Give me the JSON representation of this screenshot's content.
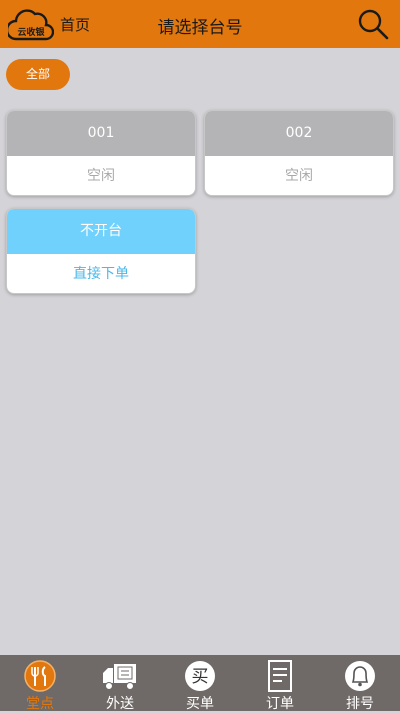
{
  "header": {
    "logo_text": "云收银",
    "home_label": "首页",
    "title": "请选择台号"
  },
  "filter": {
    "label": "全部"
  },
  "tables": [
    {
      "number": "001",
      "status": "空闲"
    },
    {
      "number": "002",
      "status": "空闲"
    },
    {
      "number": "不开台",
      "status": "直接下单"
    }
  ],
  "tabbar": {
    "items": [
      {
        "label": "堂点",
        "icon": "dine-in-icon"
      },
      {
        "label": "外送",
        "icon": "delivery-truck-icon"
      },
      {
        "label": "买单",
        "icon": "checkout-icon",
        "glyph": "买"
      },
      {
        "label": "订单",
        "icon": "order-list-icon"
      },
      {
        "label": "排号",
        "icon": "bell-icon"
      }
    ]
  },
  "colors": {
    "accent": "#e2770e",
    "idle_header": "#b4b4b6",
    "no_table_header": "#6fd1fc",
    "idle_text": "#a9a9a9",
    "no_table_text": "#4ab8ea"
  }
}
